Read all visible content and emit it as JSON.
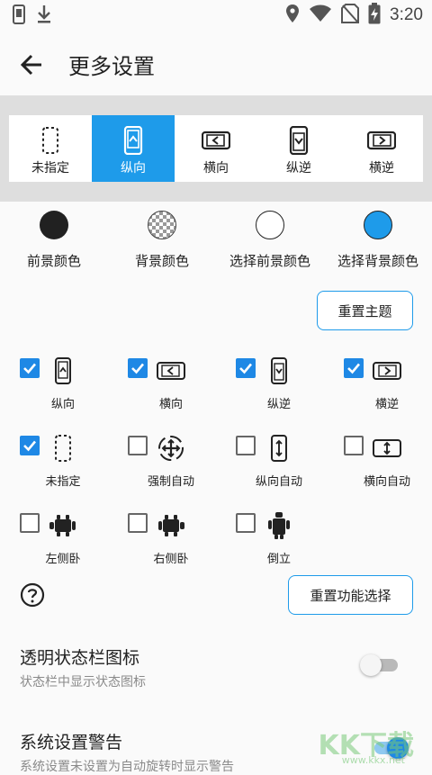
{
  "status_bar": {
    "time": "3:20",
    "left_icons": [
      "phone-screen-icon",
      "download-icon"
    ],
    "right_icons": [
      "location-icon",
      "wifi-icon",
      "no-sim-icon",
      "battery-charging-icon"
    ]
  },
  "app_bar": {
    "title": "更多设置",
    "back_icon": "arrow-back-icon"
  },
  "orientation_tabs": {
    "selected_index": 1,
    "items": [
      {
        "label": "未指定",
        "icon": "unspecified-icon"
      },
      {
        "label": "纵向",
        "icon": "portrait-icon"
      },
      {
        "label": "横向",
        "icon": "landscape-icon"
      },
      {
        "label": "纵逆",
        "icon": "reverse-portrait-icon"
      },
      {
        "label": "横逆",
        "icon": "reverse-landscape-icon"
      }
    ]
  },
  "theme_colors": [
    {
      "label": "前景颜色",
      "swatch": "#212121"
    },
    {
      "label": "背景颜色",
      "swatch": "checkerboard"
    },
    {
      "label": "选择前景颜色",
      "swatch": "#ffffff"
    },
    {
      "label": "选择背景颜色",
      "swatch": "#1e9bea"
    }
  ],
  "reset_theme_label": "重置主题",
  "functions": [
    {
      "label": "纵向",
      "checked": true,
      "icon": "portrait-icon"
    },
    {
      "label": "横向",
      "checked": true,
      "icon": "landscape-icon"
    },
    {
      "label": "纵逆",
      "checked": true,
      "icon": "reverse-portrait-icon"
    },
    {
      "label": "横逆",
      "checked": true,
      "icon": "reverse-landscape-icon"
    },
    {
      "label": "未指定",
      "checked": true,
      "icon": "unspecified-icon"
    },
    {
      "label": "强制自动",
      "checked": false,
      "icon": "force-auto-icon"
    },
    {
      "label": "纵向自动",
      "checked": false,
      "icon": "portrait-auto-icon"
    },
    {
      "label": "横向自动",
      "checked": false,
      "icon": "landscape-auto-icon"
    },
    {
      "label": "左侧卧",
      "checked": false,
      "icon": "lying-left-icon"
    },
    {
      "label": "右侧卧",
      "checked": false,
      "icon": "lying-right-icon"
    },
    {
      "label": "倒立",
      "checked": false,
      "icon": "upside-down-icon"
    }
  ],
  "help_icon": "help-icon",
  "reset_functions_label": "重置功能选择",
  "settings": [
    {
      "title": "透明状态栏图标",
      "subtitle": "状态栏中显示状态图标",
      "enabled": false
    },
    {
      "title": "系统设置警告",
      "subtitle": "系统设置未设置为自动旋转时显示警告",
      "enabled": true
    }
  ],
  "watermark": {
    "text": "KK下载",
    "sub": "www.kkx.net"
  },
  "colors": {
    "accent": "#1e9bea",
    "checkbox": "#1e88e5",
    "band": "#dedede",
    "background": "#fafafa"
  }
}
